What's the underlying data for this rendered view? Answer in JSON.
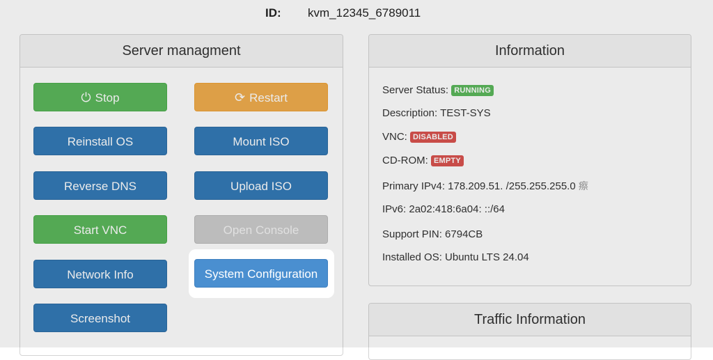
{
  "header": {
    "id_label": "ID:",
    "id_value": "kvm_12345_6789011"
  },
  "management": {
    "title": "Server managment",
    "buttons": {
      "stop": "Stop",
      "restart": "Restart",
      "reinstall_os": "Reinstall OS",
      "mount_iso": "Mount ISO",
      "reverse_dns": "Reverse DNS",
      "upload_iso": "Upload ISO",
      "start_vnc": "Start VNC",
      "open_console": "Open Console",
      "network_info": "Network Info",
      "system_configuration": "System Configuration",
      "screenshot": "Screenshot"
    },
    "icons": {
      "stop": "power-icon",
      "restart": "refresh-icon"
    }
  },
  "information": {
    "title": "Information",
    "server_status_label": "Server Status:",
    "server_status_badge": "RUNNING",
    "description": "Description: TEST-SYS",
    "vnc_label": "VNC:",
    "vnc_badge": "DISABLED",
    "cdrom_label": "CD-ROM:",
    "cdrom_badge": "EMPTY",
    "primary_ipv4": "Primary IPv4: 178.209.51.  /255.255.255.0",
    "ipv4_glyph": "瘵",
    "ipv6": "IPv6: 2a02:418:6a04:    ::/64",
    "support_pin": "Support PIN: 6794CB",
    "installed_os": "Installed OS: Ubuntu LTS 24.04"
  },
  "traffic": {
    "title": "Traffic Information"
  },
  "colors": {
    "success": "#5cb85c",
    "warning": "#f0ad4e",
    "primary": "#337ab7",
    "danger": "#d9534f",
    "disabled": "#cccccc"
  }
}
